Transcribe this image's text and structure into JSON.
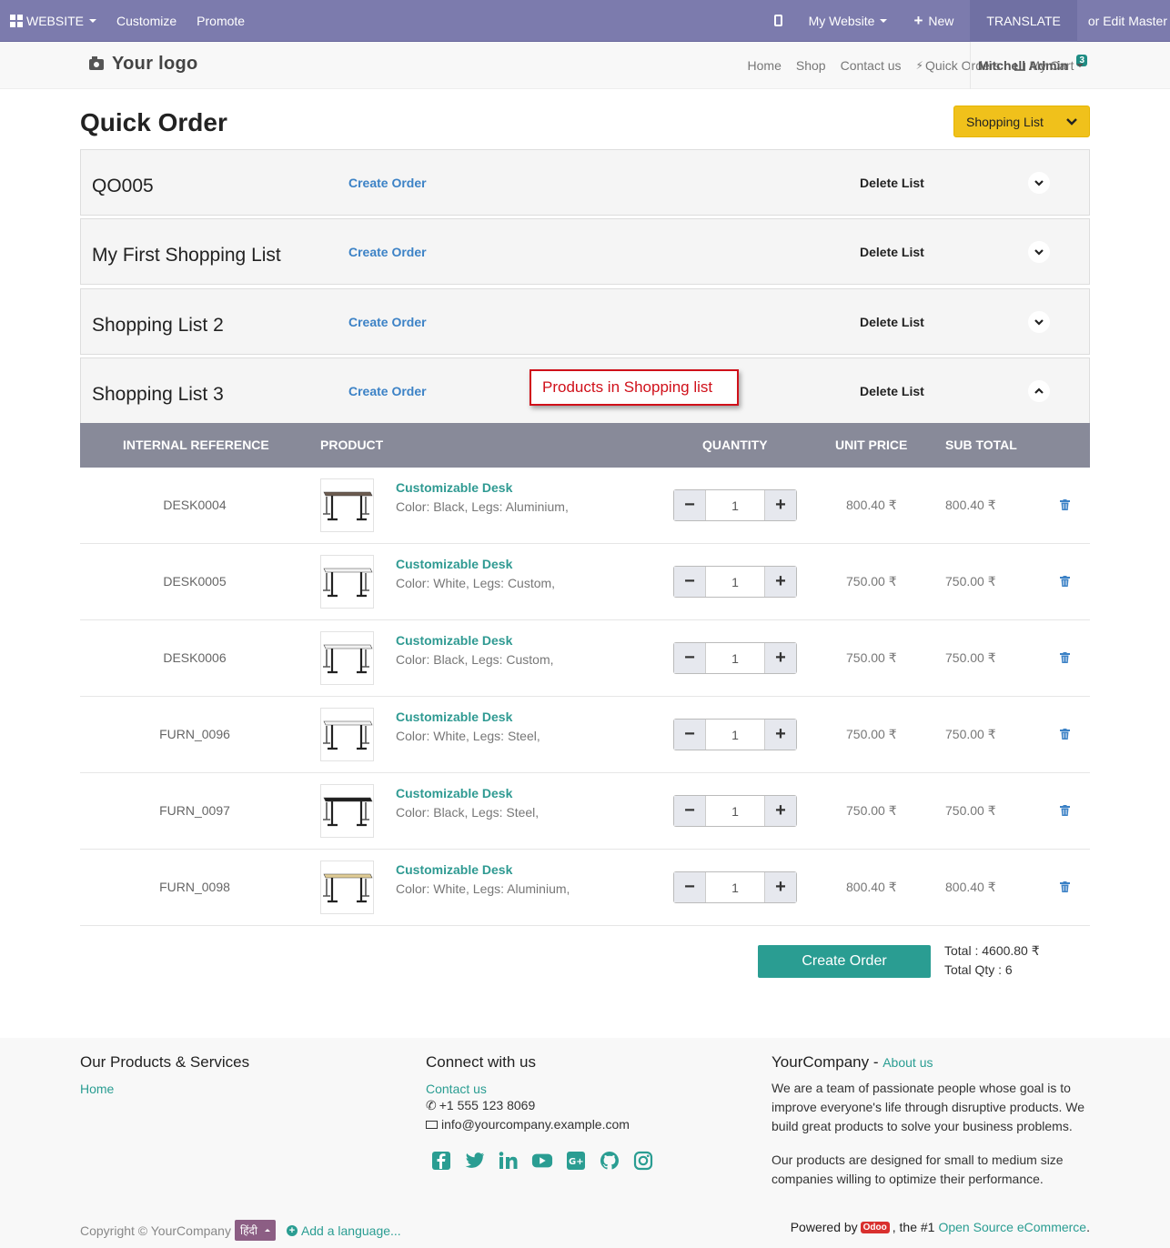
{
  "topbar": {
    "website": "WEBSITE",
    "customize": "Customize",
    "promote": "Promote",
    "my_website": "My Website",
    "new": "New",
    "translate": "TRANSLATE",
    "edit_master": "or Edit Master"
  },
  "navbar": {
    "logo": "Your logo",
    "links": [
      "Home",
      "Shop",
      "Contact us",
      "Quick Orders",
      "My Cart"
    ],
    "cart_count": "3",
    "user": "Mitchell Admin"
  },
  "page": {
    "title": "Quick Order",
    "shopping_list_button": "Shopping List"
  },
  "lists": [
    {
      "name": "QO005",
      "create": "Create Order",
      "delete": "Delete List",
      "expanded": false
    },
    {
      "name": "My First Shopping List",
      "create": "Create Order",
      "delete": "Delete List",
      "expanded": false
    },
    {
      "name": "Shopping List 2",
      "create": "Create Order",
      "delete": "Delete List",
      "expanded": false
    },
    {
      "name": "Shopping List 3",
      "create": "Create Order",
      "delete": "Delete List",
      "expanded": true
    }
  ],
  "annotation": "Products in Shopping list",
  "table": {
    "headers": [
      "INTERNAL REFERENCE",
      "PRODUCT",
      "QUANTITY",
      "UNIT PRICE",
      "SUB TOTAL"
    ],
    "rows": [
      {
        "ref": "DESK0004",
        "name": "Customizable Desk",
        "attrs": "Color: Black, Legs: Aluminium,",
        "qty": "1",
        "unit_price": "800.40 ₹",
        "subtotal": "800.40 ₹",
        "top_color": "#6b5a4e"
      },
      {
        "ref": "DESK0005",
        "name": "Customizable Desk",
        "attrs": "Color: White, Legs: Custom,",
        "qty": "1",
        "unit_price": "750.00 ₹",
        "subtotal": "750.00 ₹",
        "top_color": "#f2f2f2"
      },
      {
        "ref": "DESK0006",
        "name": "Customizable Desk",
        "attrs": "Color: Black, Legs: Custom,",
        "qty": "1",
        "unit_price": "750.00 ₹",
        "subtotal": "750.00 ₹",
        "top_color": "#f2f2f2"
      },
      {
        "ref": "FURN_0096",
        "name": "Customizable Desk",
        "attrs": "Color: White, Legs: Steel,",
        "qty": "1",
        "unit_price": "750.00 ₹",
        "subtotal": "750.00 ₹",
        "top_color": "#f2f2f2"
      },
      {
        "ref": "FURN_0097",
        "name": "Customizable Desk",
        "attrs": "Color: Black, Legs: Steel,",
        "qty": "1",
        "unit_price": "750.00 ₹",
        "subtotal": "750.00 ₹",
        "top_color": "#1e1e1e"
      },
      {
        "ref": "FURN_0098",
        "name": "Customizable Desk",
        "attrs": "Color: White, Legs: Aluminium,",
        "qty": "1",
        "unit_price": "800.40 ₹",
        "subtotal": "800.40 ₹",
        "top_color": "#e0cc95"
      }
    ]
  },
  "order": {
    "create_button": "Create Order",
    "total": "Total : 4600.80 ₹",
    "total_qty": "Total Qty : 6"
  },
  "footer": {
    "col1_title": "Our Products & Services",
    "col1_link": "Home",
    "col2_title": "Connect with us",
    "col2_link": "Contact us",
    "phone": "+1 555 123 8069",
    "email": "info@yourcompany.example.com",
    "social": [
      "facebook-icon",
      "twitter-icon",
      "linkedin-icon",
      "youtube-icon",
      "google-plus-icon",
      "github-icon",
      "instagram-icon"
    ],
    "col3_title": "YourCompany - ",
    "col3_link": "About us",
    "about_p1": "We are a team of passionate people whose goal is to improve everyone's life through disruptive products. We build great products to solve your business problems.",
    "about_p2": "Our products are designed for small to medium size companies willing to optimize their performance.",
    "copyright": "Copyright © YourCompany",
    "lang": "हिंदी",
    "add_language": "Add a language...",
    "powered_by": "Powered by",
    "odoo": "Odoo",
    "powered_mid": ", the #1",
    "powered_link": "Open Source eCommerce",
    "powered_end": "."
  },
  "colors": {
    "topbar": "#7c7bad",
    "accent": "#2a9d92",
    "link_blue": "#3c82c6",
    "shopping_list_btn": "#f0c11b",
    "table_header": "#888a99"
  }
}
